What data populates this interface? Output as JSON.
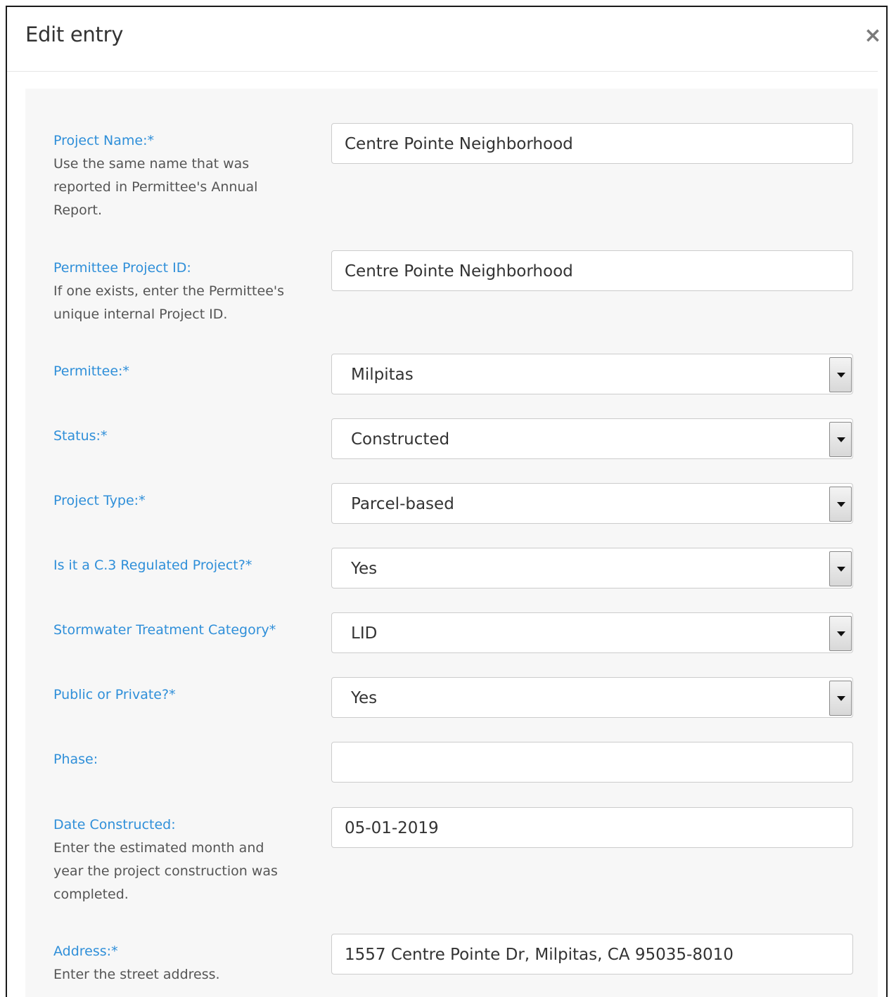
{
  "modal": {
    "title": "Edit entry",
    "close_glyph": "×"
  },
  "fields": {
    "project_name": {
      "label": "Project Name:*",
      "help": [
        "Use the same name that was",
        "reported in Permittee's Annual",
        "Report."
      ],
      "value": "Centre Pointe Neighborhood"
    },
    "permittee_project_id": {
      "label": "Permittee Project ID:",
      "help": [
        "If one exists, enter the Permittee's",
        "unique internal Project ID."
      ],
      "value": "Centre Pointe Neighborhood"
    },
    "permittee": {
      "label": "Permittee:*",
      "value": "Milpitas"
    },
    "status": {
      "label": "Status:*",
      "value": "Constructed"
    },
    "project_type": {
      "label": "Project Type:*",
      "value": "Parcel-based"
    },
    "c3_regulated": {
      "label": "Is it a C.3 Regulated Project?*",
      "value": "Yes"
    },
    "stormwater_category": {
      "label": "Stormwater Treatment Category*",
      "value": "LID"
    },
    "public_private": {
      "label": "Public or Private?*",
      "value": "Yes"
    },
    "phase": {
      "label": "Phase:",
      "value": ""
    },
    "date_constructed": {
      "label": "Date Constructed:",
      "help": [
        "Enter the estimated month and",
        "year the project construction was",
        "completed."
      ],
      "value": "05-01-2019"
    },
    "address": {
      "label": "Address:*",
      "help": [
        "Enter the street address."
      ],
      "value": "1557 Centre Pointe Dr, Milpitas, CA 95035-8010"
    }
  },
  "icons": {
    "close": "close-icon",
    "dropdown": "chevron-down-icon"
  },
  "colors": {
    "label": "#2f8fd9",
    "help": "#555555",
    "form_bg": "#f7f7f7",
    "border": "#cccccc"
  }
}
